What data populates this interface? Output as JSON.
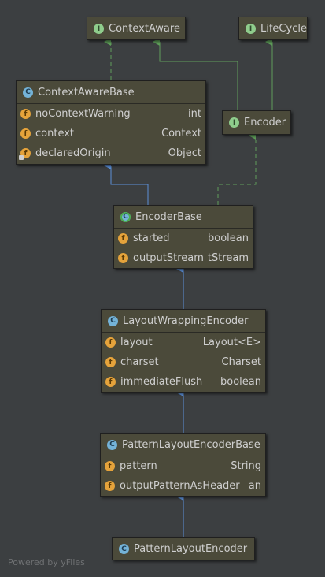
{
  "nodes": {
    "contextaware": {
      "title": "ContextAware",
      "kind": "interface"
    },
    "lifecycle": {
      "title": "LifeCycle",
      "kind": "interface"
    },
    "contextawarebase": {
      "title": "ContextAwareBase",
      "kind": "class",
      "fields": [
        {
          "name": "noContextWarning",
          "type": "int"
        },
        {
          "name": "context",
          "type": "Context"
        },
        {
          "name": "declaredOrigin",
          "type": "Object"
        }
      ]
    },
    "encoder": {
      "title": "Encoder",
      "kind": "interface"
    },
    "encoderbase": {
      "title": "EncoderBase",
      "kind": "abstract",
      "fields": [
        {
          "name": "started",
          "type": "boolean"
        },
        {
          "name": "outputStream",
          "type": "tStream"
        }
      ]
    },
    "layoutwrappingencoder": {
      "title": "LayoutWrappingEncoder",
      "kind": "class",
      "fields": [
        {
          "name": "layout",
          "type": "Layout<E>"
        },
        {
          "name": "charset",
          "type": "Charset"
        },
        {
          "name": "immediateFlush",
          "type": "boolean"
        }
      ]
    },
    "patternlayoutencoderbase": {
      "title": "PatternLayoutEncoderBase",
      "kind": "class",
      "fields": [
        {
          "name": "pattern",
          "type": "String"
        },
        {
          "name": "outputPatternAsHeader",
          "type": "an"
        }
      ]
    },
    "patternlayoutencoder": {
      "title": "PatternLayoutEncoder",
      "kind": "class"
    }
  },
  "badges": {
    "interface": "I",
    "class": "C",
    "abstract": "C",
    "field": "f"
  },
  "colors": {
    "background": "#3c3f41",
    "node_fill": "#4b4a3a",
    "implements_edge": "#5f9e5a",
    "extends_edge": "#5b8fd6"
  },
  "footer": {
    "text": "Powered by yFiles"
  }
}
